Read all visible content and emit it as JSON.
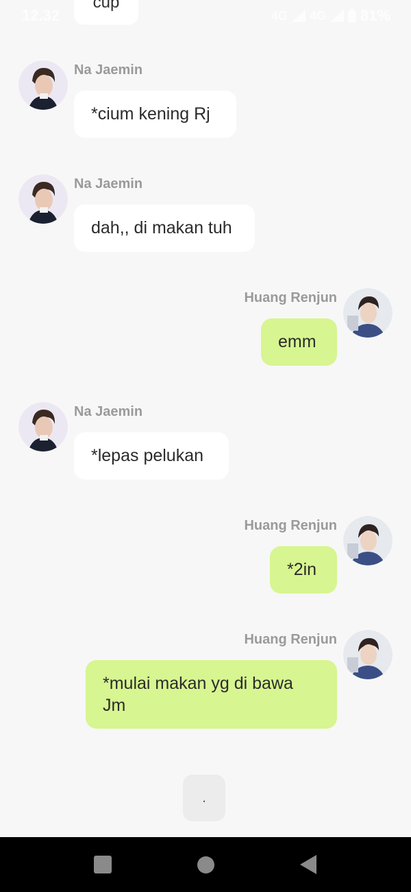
{
  "status_bar": {
    "time": "12.32",
    "network1": "4G",
    "network2": "4G",
    "battery": "81%"
  },
  "partial_message": "cup",
  "messages": [
    {
      "sender": "Na Jaemin",
      "text": "*cium kening Rj"
    },
    {
      "sender": "Na Jaemin",
      "text": "dah,, di makan tuh"
    },
    {
      "sender": "Huang Renjun",
      "text": "emm"
    },
    {
      "sender": "Na Jaemin",
      "text": "*lepas pelukan"
    },
    {
      "sender": "Huang Renjun",
      "text": "*2in"
    },
    {
      "sender": "Huang Renjun",
      "text": "*mulai makan yg di bawa Jm"
    }
  ],
  "typing_indicator": ".",
  "colors": {
    "incoming_bubble": "#ffffff",
    "outgoing_bubble": "#d7f590",
    "background": "#f7f7f7"
  }
}
